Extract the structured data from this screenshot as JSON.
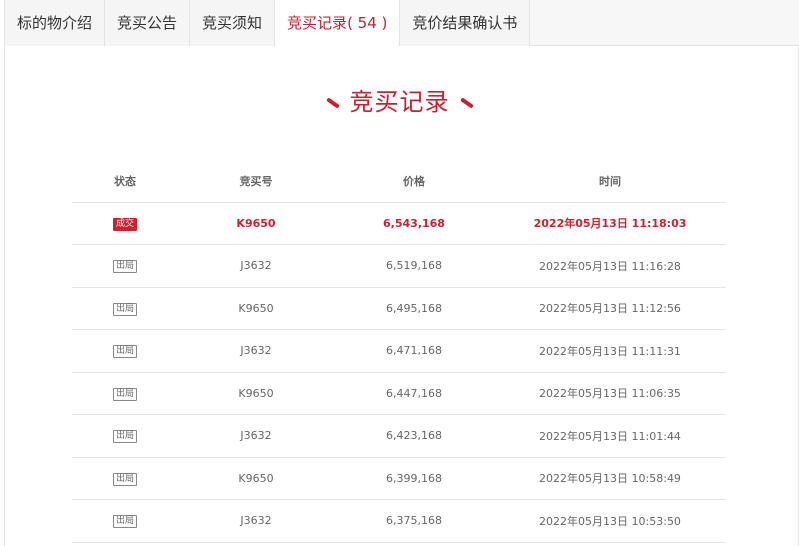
{
  "tabs": [
    {
      "label": "标的物介绍"
    },
    {
      "label": "竞买公告"
    },
    {
      "label": "竞买须知"
    },
    {
      "label": "竞买记录",
      "count": "( 54 )"
    },
    {
      "label": "竞价结果确认书"
    }
  ],
  "section": {
    "title": "竞买记录"
  },
  "table": {
    "headers": {
      "status": "状态",
      "bid_number": "竞买号",
      "price": "价格",
      "time": "时间"
    },
    "rows": [
      {
        "status": "成交",
        "bid_number": "K9650",
        "price": "6,543,168",
        "time": "2022年05月13日 11:18:03"
      },
      {
        "status": "出局",
        "bid_number": "J3632",
        "price": "6,519,168",
        "time": "2022年05月13日 11:16:28"
      },
      {
        "status": "出局",
        "bid_number": "K9650",
        "price": "6,495,168",
        "time": "2022年05月13日 11:12:56"
      },
      {
        "status": "出局",
        "bid_number": "J3632",
        "price": "6,471,168",
        "time": "2022年05月13日 11:11:31"
      },
      {
        "status": "出局",
        "bid_number": "K9650",
        "price": "6,447,168",
        "time": "2022年05月13日 11:06:35"
      },
      {
        "status": "出局",
        "bid_number": "J3632",
        "price": "6,423,168",
        "time": "2022年05月13日 11:01:44"
      },
      {
        "status": "出局",
        "bid_number": "K9650",
        "price": "6,399,168",
        "time": "2022年05月13日 10:58:49"
      },
      {
        "status": "出局",
        "bid_number": "J3632",
        "price": "6,375,168",
        "time": "2022年05月13日 10:53:50"
      }
    ]
  },
  "colors": {
    "accent": "#c8202f",
    "deal_text": "#d0202e"
  }
}
